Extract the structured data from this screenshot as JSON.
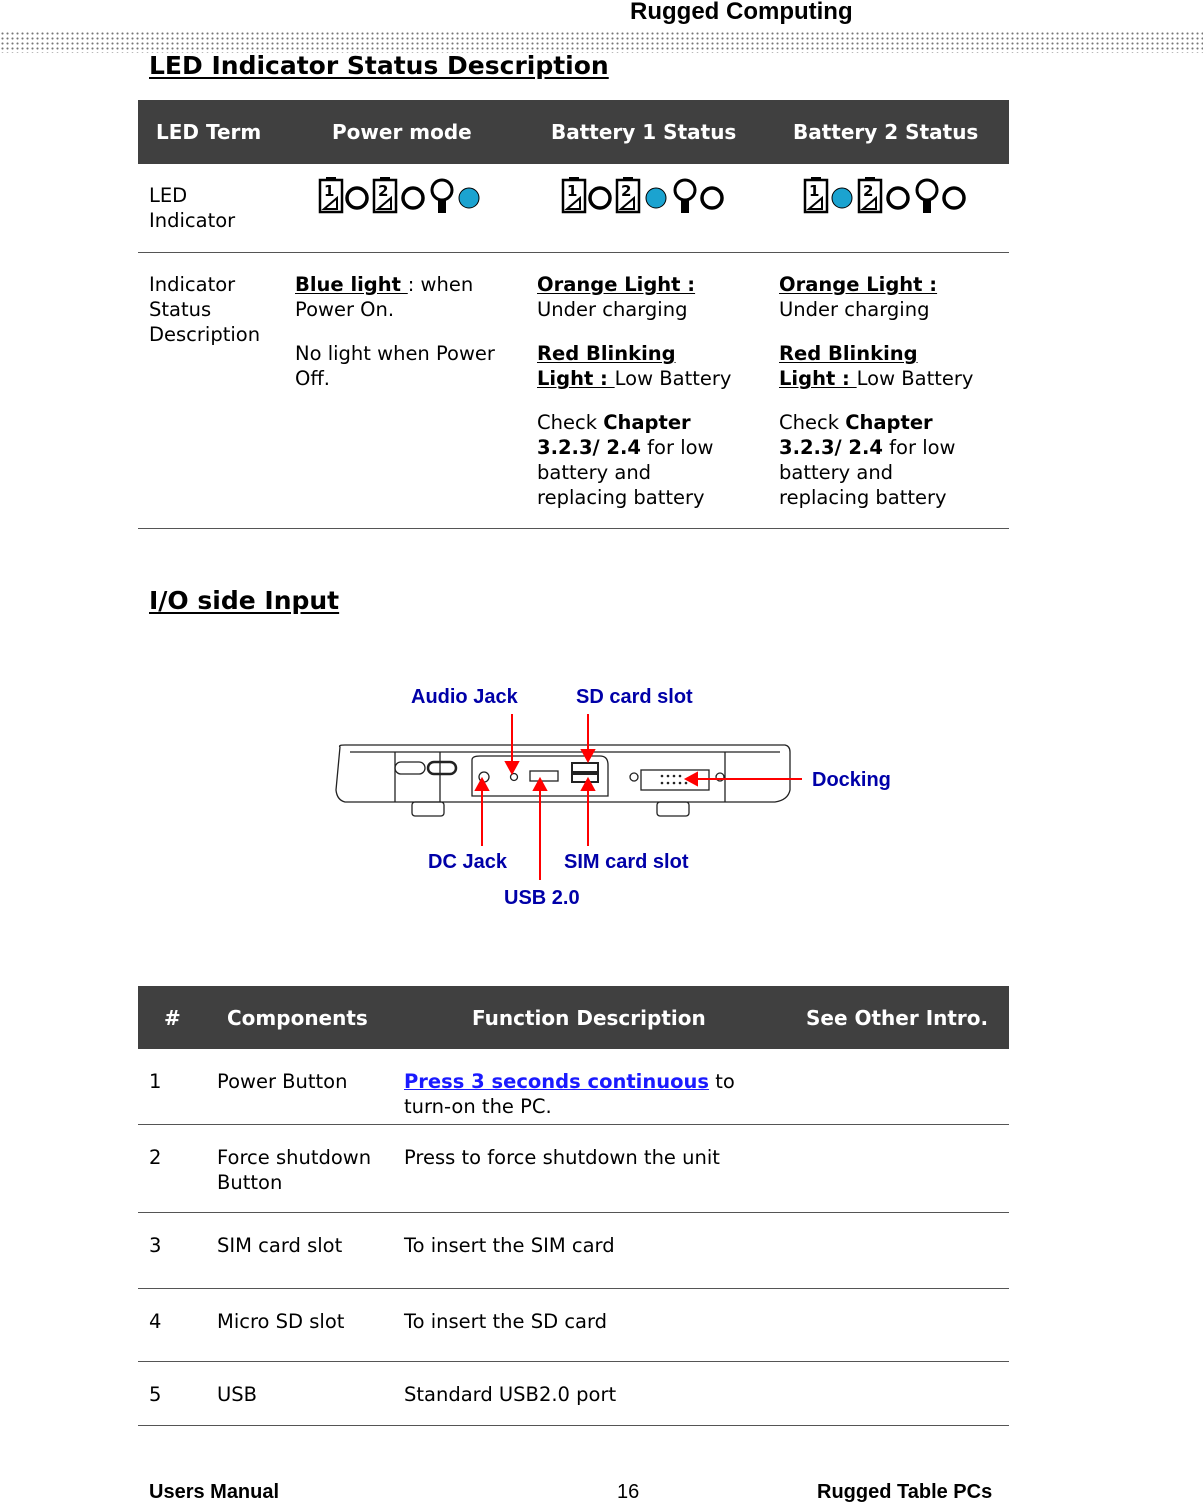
{
  "header": {
    "title": "Rugged  Computing"
  },
  "led_section": {
    "title": "LED Indicator Status Description",
    "columns": [
      "LED Term",
      "Power mode",
      "Battery 1 Status",
      "Battery 2 Status"
    ],
    "row1_label": [
      "LED",
      "Indicator"
    ],
    "led_color": "#1ba3d0",
    "row2": {
      "label": [
        "Indicator",
        "Status",
        "Description"
      ],
      "power": {
        "b1": "Blue light ",
        "t1": ": when",
        "t2": "Power On.",
        "t3": "No light when Power",
        "t4": "Off."
      },
      "battery": {
        "o_b": "Orange Light : ",
        "o_t": "Under charging",
        "r_b1": "Red Blinking ",
        "r_b2": "Light : ",
        "r_t": "Low Battery",
        "c1": "Check ",
        "c1b": "Chapter",
        "c2b": "3.2.3/ 2.4",
        "c2": " for low",
        "c3": "battery and",
        "c4": "replacing battery"
      }
    }
  },
  "io_section": {
    "title": "I/O side Input ",
    "labels": {
      "audio": "Audio Jack",
      "sd": "SD card slot",
      "docking": "Docking",
      "dc": "DC Jack",
      "sim": "SIM card slot",
      "usb": "USB 2.0"
    },
    "label_color": "#0000a8",
    "arrow_color": "#ff0000"
  },
  "components": {
    "columns": [
      "#",
      "Components",
      "Function Description",
      "See Other Intro."
    ],
    "rows": [
      {
        "n": "1",
        "name": [
          "Power Button"
        ],
        "link": "Press 3 seconds continuous",
        "desc": [
          " to",
          "turn-on the PC."
        ]
      },
      {
        "n": "2",
        "name": [
          "Force shutdown",
          "Button"
        ],
        "desc": [
          "Press to force shutdown the unit"
        ]
      },
      {
        "n": "3",
        "name": [
          "SIM card slot"
        ],
        "desc": [
          "To insert the SIM card"
        ]
      },
      {
        "n": "4",
        "name": [
          "Micro SD slot"
        ],
        "desc": [
          "To insert the SD card"
        ]
      },
      {
        "n": "5",
        "name": [
          "USB"
        ],
        "desc": [
          "Standard USB2.0 port"
        ]
      }
    ]
  },
  "footer": {
    "left": "Users Manual",
    "page": "16",
    "right": "Rugged Table PCs"
  }
}
